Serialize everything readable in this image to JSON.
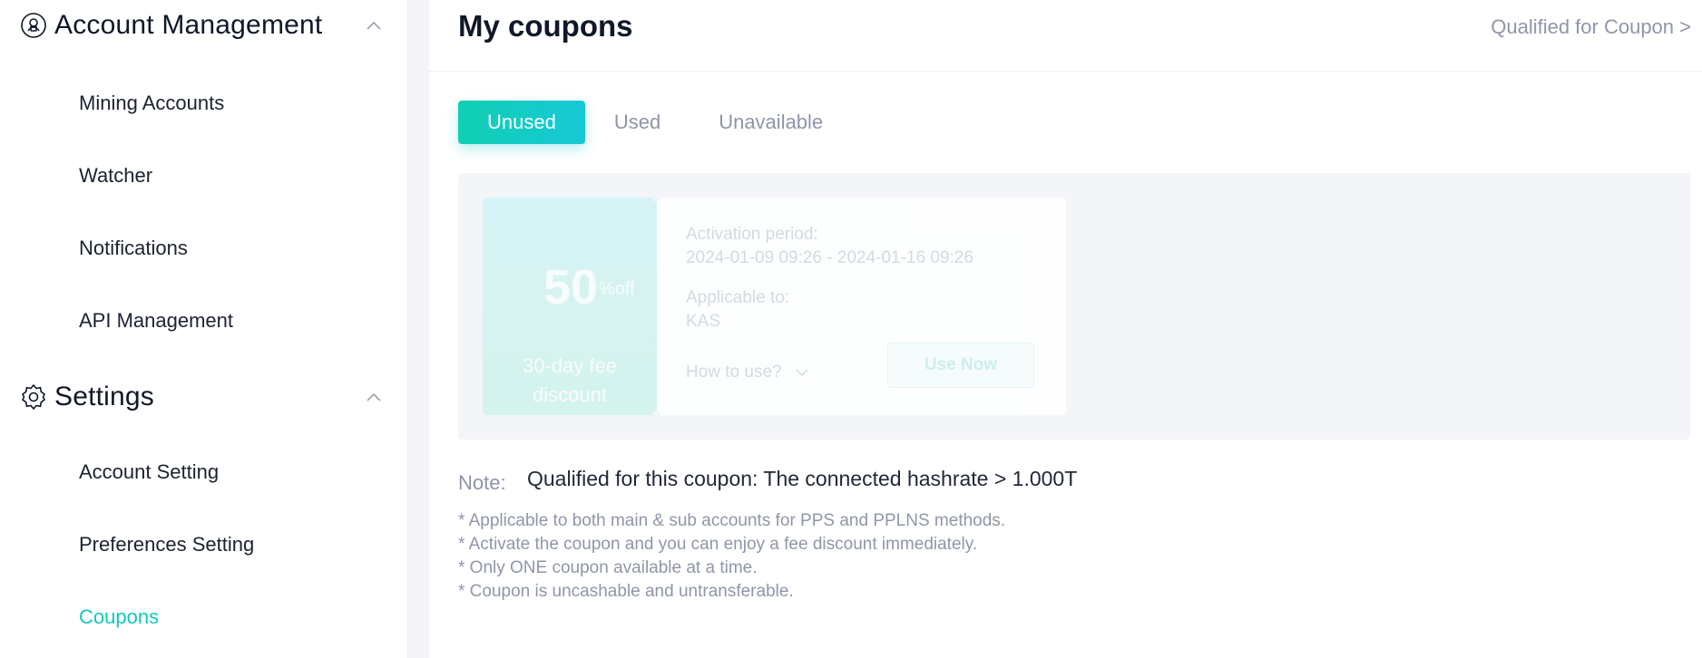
{
  "sidebar": {
    "sections": [
      {
        "title": "Account Management",
        "icon": "user-circle-icon",
        "items": [
          "Mining Accounts",
          "Watcher",
          "Notifications",
          "API Management"
        ]
      },
      {
        "title": "Settings",
        "icon": "gear-icon",
        "items": [
          "Account Setting",
          "Preferences Setting",
          "Coupons"
        ]
      }
    ],
    "active_item": "Coupons"
  },
  "header": {
    "title": "My coupons",
    "qualified_link": "Qualified for Coupon >"
  },
  "tabs": [
    {
      "label": "Unused",
      "active": true
    },
    {
      "label": "Used",
      "active": false
    },
    {
      "label": "Unavailable",
      "active": false
    }
  ],
  "coupon": {
    "discount_value": "50",
    "discount_unit": "%off",
    "discount_desc": "30-day fee discount",
    "activation_label": "Activation period:",
    "activation_period": "2024-01-09 09:26 - 2024-01-16 09:26",
    "applicable_label": "Applicable to:",
    "applicable_value": "KAS",
    "how_to_use": "How to use?",
    "use_now": "Use Now",
    "tooltip": "Qualified for this coupon: The connected hashrate > 1.000T"
  },
  "note": {
    "title": "Note:",
    "lines": [
      "* Applicable to both main & sub accounts for PPS and PPLNS methods.",
      "* Activate the coupon and you can enjoy a fee discount immediately.",
      "* Only ONE coupon available at a time.",
      "* Coupon is uncashable and untransferable."
    ]
  },
  "colors": {
    "accent": "#14c8c0",
    "muted": "#8f96a8",
    "panel_bg": "#f4f5f8"
  }
}
